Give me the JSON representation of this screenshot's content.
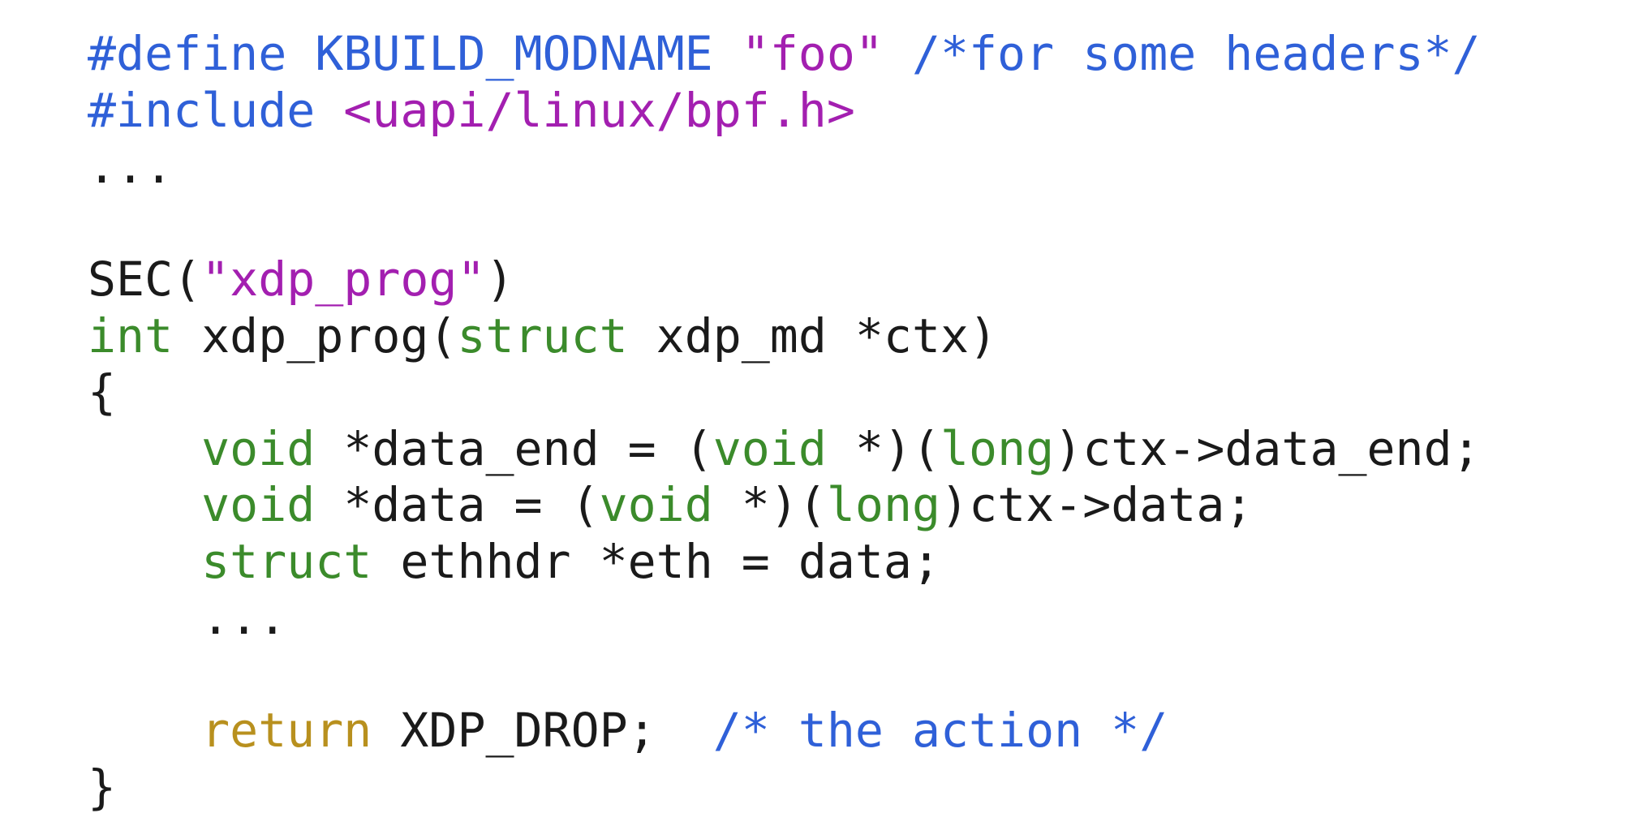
{
  "code": {
    "lines": [
      [
        {
          "text": "#define KBUILD_MODNAME ",
          "kind": "blue"
        },
        {
          "text": "\"foo\"",
          "kind": "purple"
        },
        {
          "text": " ",
          "kind": "plain"
        },
        {
          "text": "/*for some headers*/",
          "kind": "blue"
        }
      ],
      [
        {
          "text": "#include ",
          "kind": "blue"
        },
        {
          "text": "<uapi/linux/bpf.h>",
          "kind": "purple"
        }
      ],
      [
        {
          "text": "...",
          "kind": "plain"
        }
      ],
      [],
      [
        {
          "text": "SEC(",
          "kind": "plain"
        },
        {
          "text": "\"xdp_prog\"",
          "kind": "purple"
        },
        {
          "text": ")",
          "kind": "plain"
        }
      ],
      [
        {
          "text": "int",
          "kind": "green"
        },
        {
          "text": " xdp_prog(",
          "kind": "plain"
        },
        {
          "text": "struct",
          "kind": "green"
        },
        {
          "text": " xdp_md *ctx)",
          "kind": "plain"
        }
      ],
      [
        {
          "text": "{",
          "kind": "plain"
        }
      ],
      [
        {
          "text": "    ",
          "kind": "plain"
        },
        {
          "text": "void",
          "kind": "green"
        },
        {
          "text": " *data_end = (",
          "kind": "plain"
        },
        {
          "text": "void",
          "kind": "green"
        },
        {
          "text": " *)(",
          "kind": "plain"
        },
        {
          "text": "long",
          "kind": "green"
        },
        {
          "text": ")ctx->data_end;",
          "kind": "plain"
        }
      ],
      [
        {
          "text": "    ",
          "kind": "plain"
        },
        {
          "text": "void",
          "kind": "green"
        },
        {
          "text": " *data = (",
          "kind": "plain"
        },
        {
          "text": "void",
          "kind": "green"
        },
        {
          "text": " *)(",
          "kind": "plain"
        },
        {
          "text": "long",
          "kind": "green"
        },
        {
          "text": ")ctx->data;",
          "kind": "plain"
        }
      ],
      [
        {
          "text": "    ",
          "kind": "plain"
        },
        {
          "text": "struct",
          "kind": "green"
        },
        {
          "text": " ethhdr *eth = data;",
          "kind": "plain"
        }
      ],
      [
        {
          "text": "    ...",
          "kind": "plain"
        }
      ],
      [],
      [
        {
          "text": "    ",
          "kind": "plain"
        },
        {
          "text": "return",
          "kind": "gold"
        },
        {
          "text": " XDP_DROP;  ",
          "kind": "plain"
        },
        {
          "text": "/* the action */",
          "kind": "blue"
        }
      ],
      [
        {
          "text": "}",
          "kind": "plain"
        }
      ]
    ]
  },
  "colors": {
    "blue": "#2f60d8",
    "purple": "#a31fb0",
    "green": "#3b8b2b",
    "gold": "#b8901e",
    "plain": "#1a1a1a",
    "background": "#ffffff"
  }
}
